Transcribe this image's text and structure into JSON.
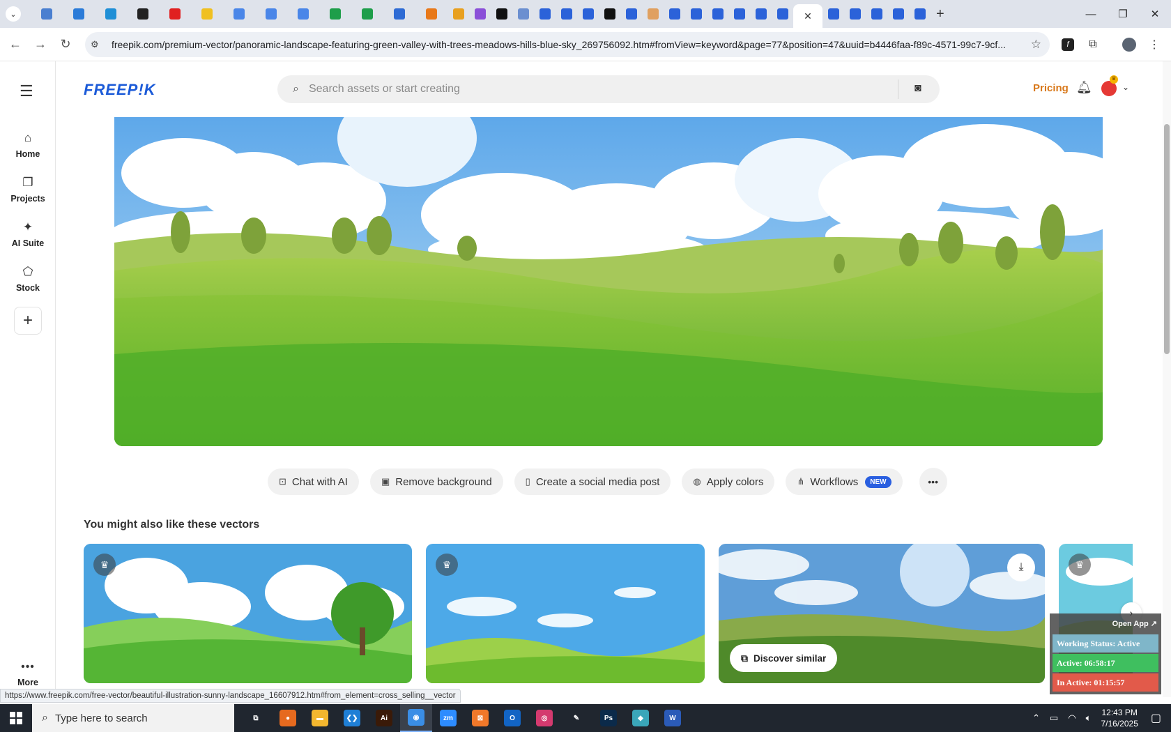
{
  "browser": {
    "url": "freepik.com/premium-vector/panoramic-landscape-featuring-green-valley-with-trees-meadows-hills-blue-sky_269756092.htm#fromView=keyword&page=77&position=47&uuid=b4446faa-f89c-4571-99c7-9cf...",
    "status_url": "https://www.freepik.com/free-vector/beautiful-illustration-sunny-landscape_16607912.htm#from_element=cross_selling__vector",
    "tab_colors": [
      "#4a7fd0",
      "#2b7bd8",
      "#1f8fd6",
      "#222222",
      "#e02020",
      "#f0c020",
      "#4a86e8",
      "#4a86e8",
      "#4a86e8",
      "#1e9e4a",
      "#1e9e4a",
      "#2e6bd4",
      "#e8791a",
      "#e8a020",
      "#8a4fd8",
      "#111111",
      "#6b8fd0",
      "#2b62d9",
      "#2b62d9",
      "#2b62d9",
      "#111111",
      "#2b62d9",
      "#e0a060",
      "#2b62d9",
      "#2b62d9",
      "#2b62d9",
      "#2b62d9",
      "#2b62d9",
      "#2b62d9"
    ],
    "tab_colors_after": [
      "#2b62d9",
      "#2b62d9",
      "#2b62d9",
      "#2b62d9",
      "#2b62d9"
    ],
    "active_tab_close": "✕",
    "new_tab": "+"
  },
  "sidebar": {
    "items": [
      {
        "label": "Home",
        "icon": "home-icon",
        "glyph": "⌂"
      },
      {
        "label": "Projects",
        "icon": "projects-icon",
        "glyph": "❐"
      },
      {
        "label": "AI Suite",
        "icon": "ai-suite-icon",
        "glyph": "✦"
      },
      {
        "label": "Stock",
        "icon": "stock-icon",
        "glyph": "⬠"
      }
    ],
    "more_label": "More"
  },
  "header": {
    "logo": "FREEP!K",
    "search_placeholder": "Search assets or start creating",
    "pricing_label": "Pricing"
  },
  "actions": [
    {
      "label": "Chat with AI",
      "icon": "chat-ai-icon",
      "glyph": "⊡"
    },
    {
      "label": "Remove background",
      "icon": "remove-bg-icon",
      "glyph": "▣"
    },
    {
      "label": "Create a social media post",
      "icon": "phone-icon",
      "glyph": "▯"
    },
    {
      "label": "Apply colors",
      "icon": "palette-icon",
      "glyph": "◍"
    },
    {
      "label": "Workflows",
      "icon": "workflows-icon",
      "glyph": "⋔",
      "badge": "NEW"
    }
  ],
  "recommendations": {
    "title": "You might also like these vectors",
    "discover_label": "Discover similar"
  },
  "widget": {
    "open_app": "Open App ↗",
    "status": "Working Status: Active",
    "active": "Active: 06:58:17",
    "inactive": "In Active: 01:15:57",
    "status_color": "#7fb6c9",
    "active_color": "#3fbf5f",
    "inactive_color": "#e25a4a"
  },
  "taskbar": {
    "search_label": "Type here to search",
    "time": "12:43 PM",
    "date": "7/16/2025",
    "apps": [
      {
        "name": "task-view",
        "color": "#20262f",
        "text": "⧉"
      },
      {
        "name": "firefox",
        "color": "#e66a1f",
        "text": "●"
      },
      {
        "name": "file-explorer",
        "color": "#f2b62f",
        "text": "▬"
      },
      {
        "name": "vscode",
        "color": "#1f7fd6",
        "text": "❮❯"
      },
      {
        "name": "illustrator",
        "color": "#3a1a08",
        "text": "Ai"
      },
      {
        "name": "chrome",
        "color": "#3a8ee6",
        "text": "◉"
      },
      {
        "name": "zoom",
        "color": "#2d8cff",
        "text": "zm"
      },
      {
        "name": "xampp",
        "color": "#f0782a",
        "text": "⊠"
      },
      {
        "name": "outlook",
        "color": "#1264c4",
        "text": "O"
      },
      {
        "name": "creative-cloud",
        "color": "#d43a6f",
        "text": "◎"
      },
      {
        "name": "pen-tool",
        "color": "#20262f",
        "text": "✎"
      },
      {
        "name": "photoshop",
        "color": "#0b2a4a",
        "text": "Ps"
      },
      {
        "name": "app-gem",
        "color": "#3aa6b9",
        "text": "◆"
      },
      {
        "name": "word",
        "color": "#2b5bb8",
        "text": "W"
      }
    ]
  }
}
